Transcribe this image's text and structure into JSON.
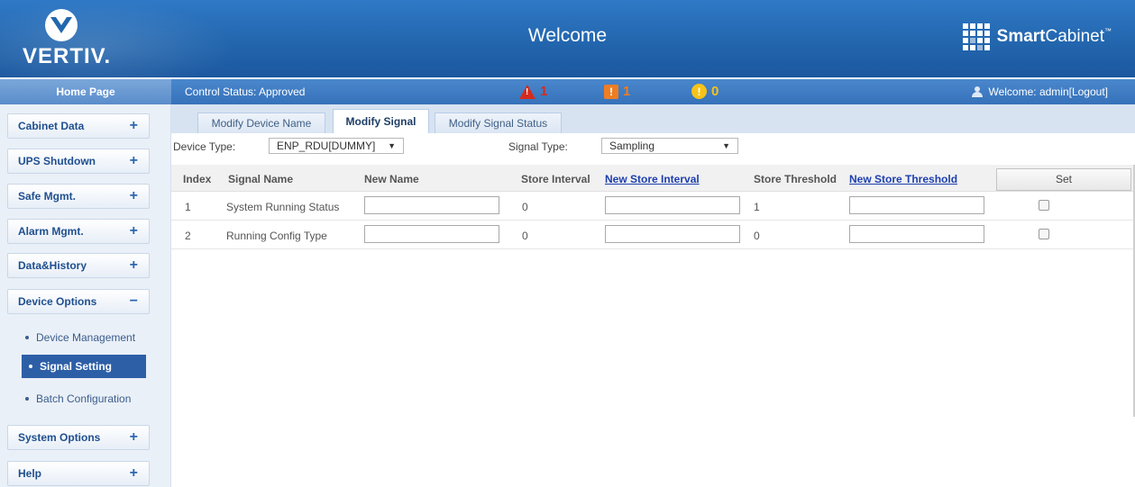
{
  "header": {
    "logo_text": "VERTIV.",
    "title": "Welcome",
    "brand_bold": "Smart",
    "brand_rest": "Cabinet",
    "brand_tm": "™"
  },
  "statusbar": {
    "home_label": "Home Page",
    "control_status": "Control Status:  Approved",
    "alarm_critical": "1",
    "alarm_major": "1",
    "alarm_minor": "0",
    "welcome_text": "Welcome: admin[Logout]"
  },
  "sidebar": {
    "items": [
      {
        "label": "Cabinet Data",
        "sign": "+"
      },
      {
        "label": "UPS Shutdown",
        "sign": "+"
      },
      {
        "label": "Safe Mgmt.",
        "sign": "+"
      },
      {
        "label": "Alarm Mgmt.",
        "sign": "+"
      },
      {
        "label": "Data&History",
        "sign": "+"
      },
      {
        "label": "Device Options",
        "sign": "−"
      },
      {
        "label": "System Options",
        "sign": "+"
      },
      {
        "label": "Help",
        "sign": "+"
      }
    ],
    "sub_items": [
      {
        "label": "Device Management"
      },
      {
        "label": "Signal Setting"
      },
      {
        "label": "Batch Configuration"
      }
    ]
  },
  "tabs": [
    {
      "label": "Modify Device Name"
    },
    {
      "label": "Modify Signal"
    },
    {
      "label": "Modify Signal Status"
    }
  ],
  "filters": {
    "device_type_label": "Device Type:",
    "device_type_value": "ENP_RDU[DUMMY]",
    "signal_type_label": "Signal Type:",
    "signal_type_value": "Sampling"
  },
  "table": {
    "headers": {
      "index": "Index",
      "signal_name": "Signal Name",
      "new_name": "New Name",
      "store_interval": "Store Interval",
      "new_store_interval": "New Store Interval",
      "store_threshold": "Store Threshold",
      "new_store_threshold": "New Store Threshold"
    },
    "set_label": "Set",
    "rows": [
      {
        "index": "1",
        "signal_name": "System Running Status",
        "store_interval": "0",
        "store_threshold": "1"
      },
      {
        "index": "2",
        "signal_name": "Running Config Type",
        "store_interval": "0",
        "store_threshold": "0"
      }
    ]
  }
}
